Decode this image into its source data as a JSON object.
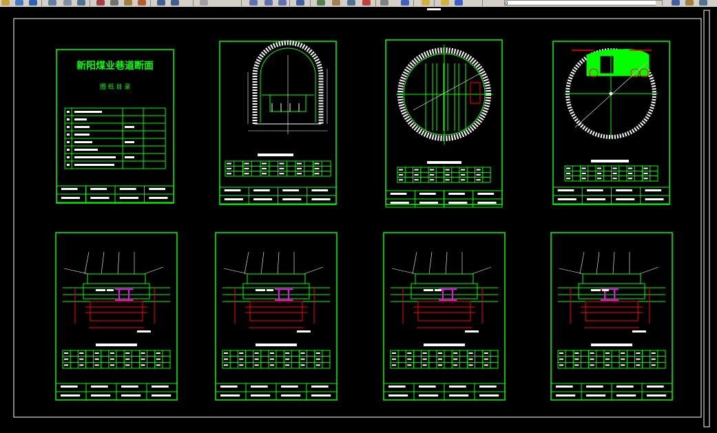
{
  "app": {
    "name": "AutoCAD drawing viewer",
    "background": "#000000",
    "line_color": "#00ff00",
    "dim_color": "#ff0000",
    "accent_color": "#ff00ff"
  },
  "toolbar": {
    "icons": [
      "new-icon",
      "open-icon",
      "save-icon",
      "print-icon",
      "preview-icon",
      "publish-icon",
      "cut-icon",
      "copy-icon",
      "paste-icon",
      "match-properties-icon",
      "undo-icon",
      "redo-icon",
      "pan-icon",
      "zoom-realtime-icon",
      "zoom-window-icon",
      "zoom-previous-icon",
      "properties-icon",
      "design-center-icon",
      "tool-palettes-icon",
      "sheet-set-icon",
      "markup-icon",
      "calculator-icon",
      "help-icon",
      "layer-icon",
      "layer-state-icon",
      "color-icon"
    ],
    "layer_value": "0"
  },
  "title_sheet": {
    "title": "新阳煤业巷道断面",
    "subtitle": "图 纸 目 录",
    "table_rows": 8
  },
  "sheets": [
    {
      "kind": "index"
    },
    {
      "kind": "arch-section"
    },
    {
      "kind": "circular-shaft"
    },
    {
      "kind": "circular-shaft-top"
    },
    {
      "kind": "rect-section"
    },
    {
      "kind": "rect-section"
    },
    {
      "kind": "rect-section"
    },
    {
      "kind": "rect-section"
    }
  ]
}
